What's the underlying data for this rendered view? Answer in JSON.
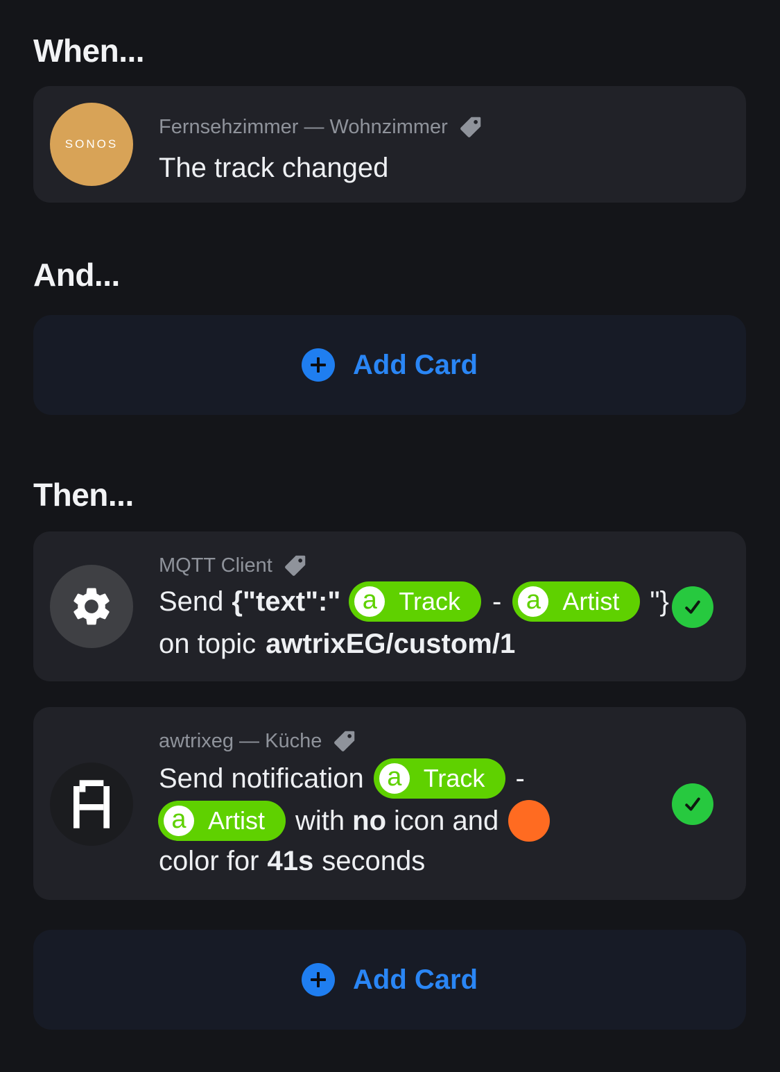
{
  "sections": {
    "when": "When...",
    "and": "And...",
    "then": "Then..."
  },
  "trigger": {
    "avatar_text": "SONOS",
    "meta": "Fernsehzimmer — Wohnzimmer",
    "title": "The track changed",
    "avatar_color": "#d8a357"
  },
  "add_card": {
    "label": "Add Card",
    "accent": "#1f7ef0"
  },
  "mqtt": {
    "meta": "MQTT Client",
    "send": "Send",
    "payload_start": "{\"text\":\"",
    "token_track": "Track",
    "dash": "-",
    "token_artist": "Artist",
    "payload_end": "\"}",
    "on_topic": "on topic",
    "topic": "awtrixEG/custom/1"
  },
  "awtrix": {
    "meta": "awtrixeg — Küche",
    "send_notification": "Send notification",
    "token_track": "Track",
    "dash": "-",
    "token_artist": "Artist",
    "with": "with",
    "no": "no",
    "icon_and": "icon and",
    "color_word": "color for",
    "duration": "41s",
    "seconds": "seconds",
    "color": "#ff6b21"
  },
  "token_icon": "a",
  "colors": {
    "token_green": "#5fd100",
    "check_green": "#27c93f"
  }
}
